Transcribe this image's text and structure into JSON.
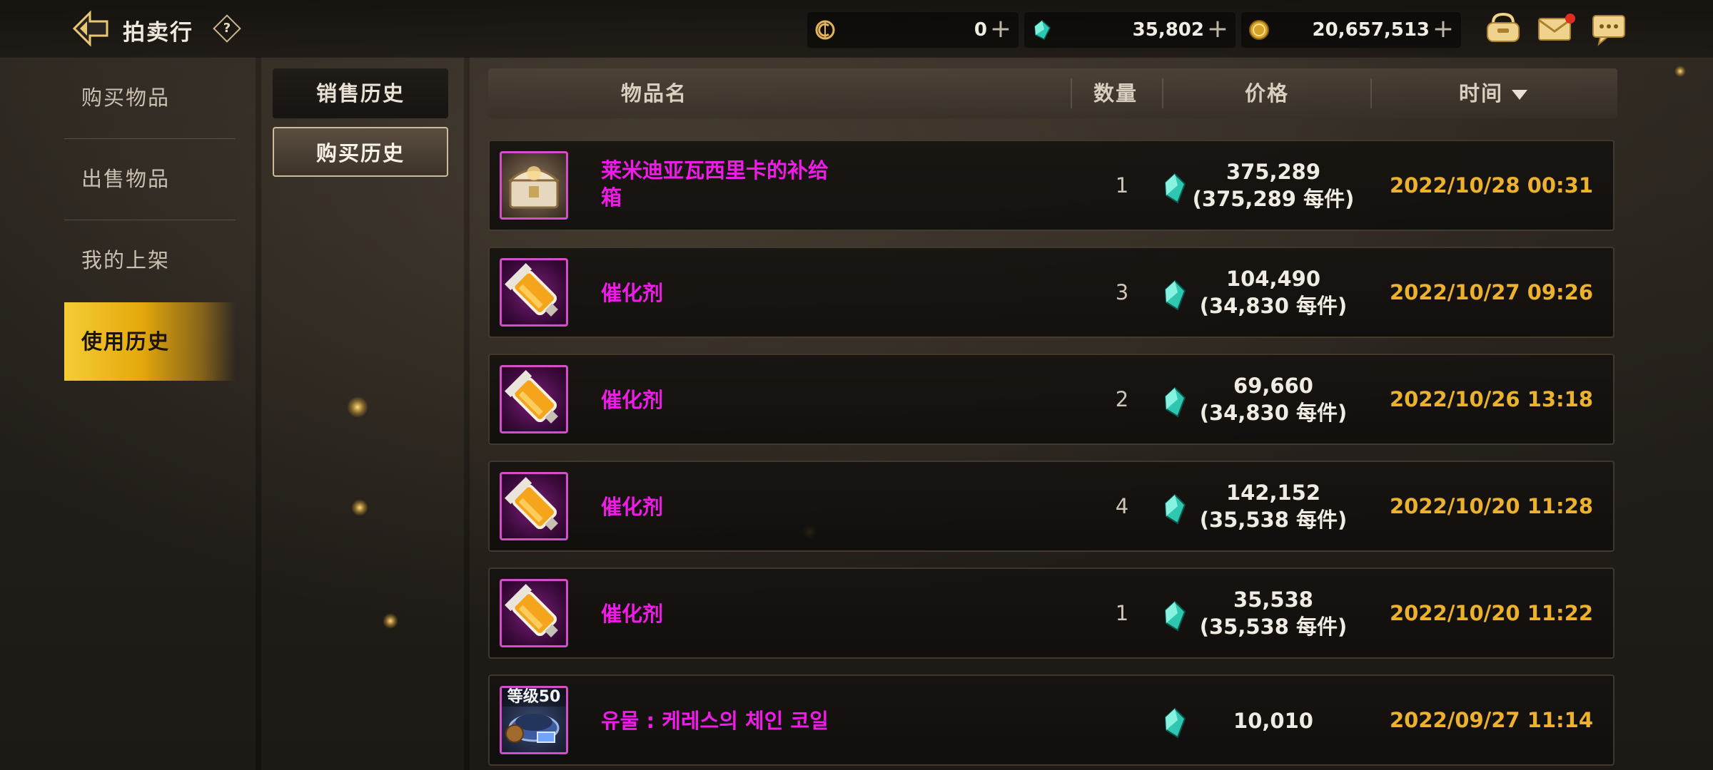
{
  "header": {
    "title": "拍卖行",
    "help_glyph": "?",
    "currencies": [
      {
        "name": "coupon",
        "icon": "coupon-icon",
        "value": "0",
        "plus": "+"
      },
      {
        "name": "gem",
        "icon": "gem-icon",
        "value": "35,802",
        "plus": "+"
      },
      {
        "name": "gold",
        "icon": "gold-coin-icon",
        "value": "20,657,513",
        "plus": "+"
      }
    ],
    "icons": [
      "inventory-bag-icon",
      "mail-icon",
      "chat-icon"
    ]
  },
  "sidebar": {
    "items": [
      {
        "label": "购买物品"
      },
      {
        "label": "出售物品"
      },
      {
        "label": "我的上架"
      },
      {
        "label": "使用历史",
        "active": true
      }
    ]
  },
  "subtabs": {
    "sales": "销售历史",
    "purchases": "购买历史"
  },
  "table": {
    "columns": {
      "name": "物品名",
      "qty": "数量",
      "price": "价格",
      "time": "时间"
    },
    "rows": [
      {
        "name_l1": "莱米迪亚瓦西里卡的补给",
        "name_l2": "箱",
        "qty": "1",
        "price": "375,289",
        "unit": "(375,289 每件)",
        "time": "2022/10/28 00:31",
        "icon": "supply-box-icon"
      },
      {
        "name_l1": "催化剂",
        "name_l2": "",
        "qty": "3",
        "price": "104,490",
        "unit": "(34,830 每件)",
        "time": "2022/10/27 09:26",
        "icon": "catalyst-vial-icon"
      },
      {
        "name_l1": "催化剂",
        "name_l2": "",
        "qty": "2",
        "price": "69,660",
        "unit": "(34,830 每件)",
        "time": "2022/10/26 13:18",
        "icon": "catalyst-vial-icon"
      },
      {
        "name_l1": "催化剂",
        "name_l2": "",
        "qty": "4",
        "price": "142,152",
        "unit": "(35,538 每件)",
        "time": "2022/10/20 11:28",
        "icon": "catalyst-vial-icon"
      },
      {
        "name_l1": "催化剂",
        "name_l2": "",
        "qty": "1",
        "price": "35,538",
        "unit": "(35,538 每件)",
        "time": "2022/10/20 11:22",
        "icon": "catalyst-vial-icon"
      },
      {
        "name_l1": "유물 : 케레스의 체인 코일",
        "name_l2": "",
        "qty": "",
        "price": "10,010",
        "unit": "",
        "time": "2022/09/27 11:14",
        "icon": "relic-chain-coil-icon",
        "badge": "等级50"
      }
    ]
  }
}
